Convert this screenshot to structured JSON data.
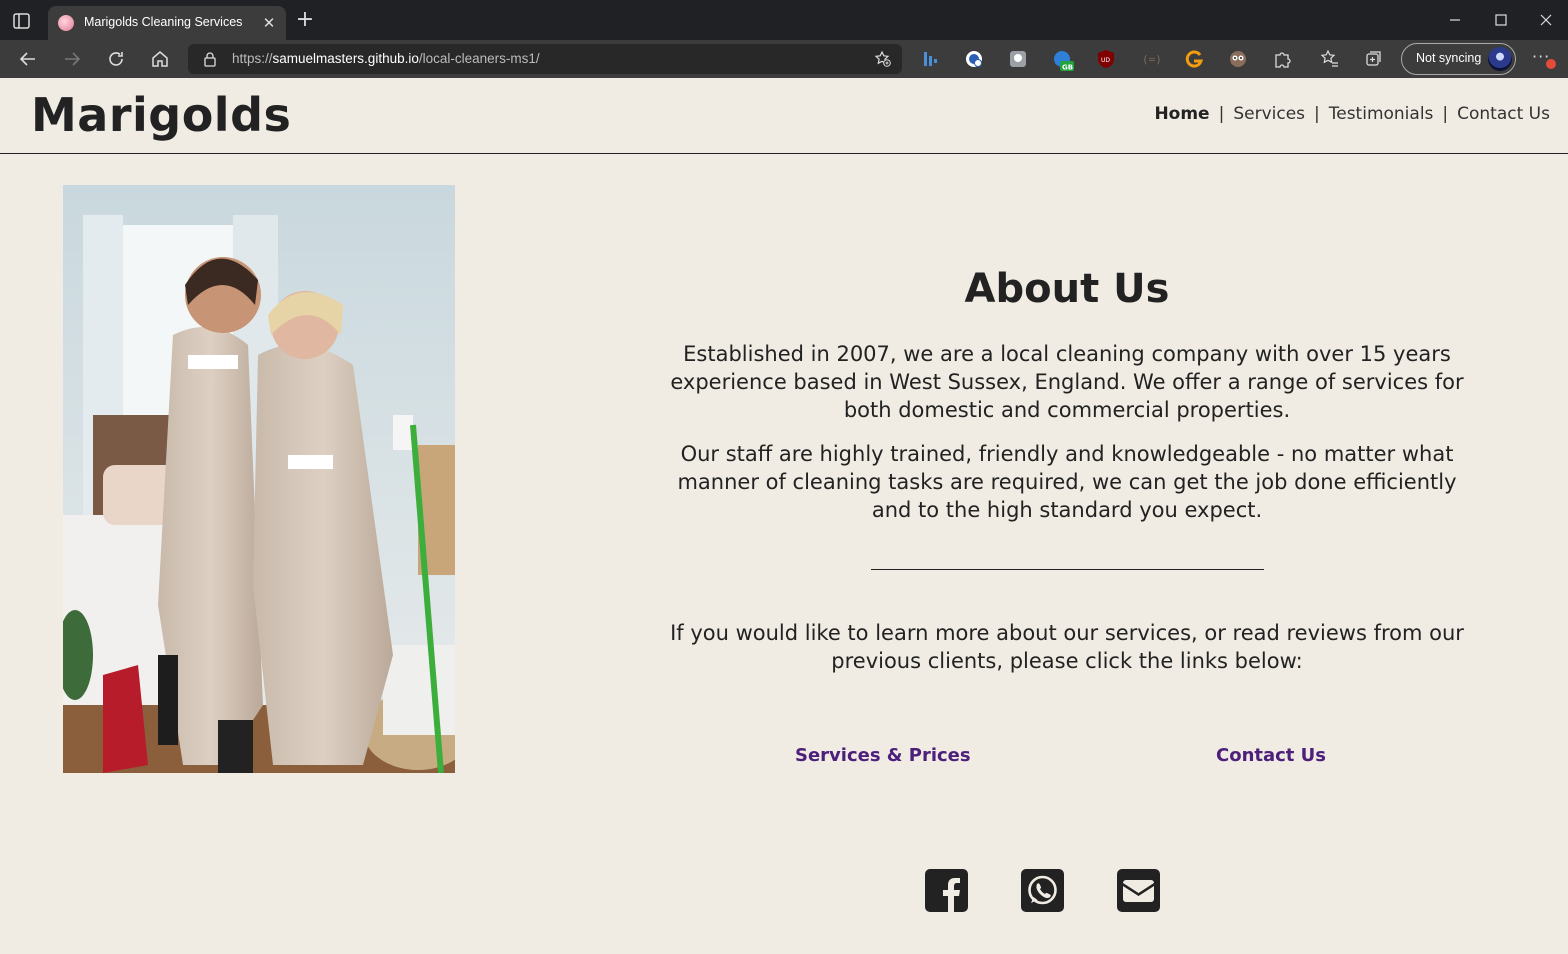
{
  "browser": {
    "tab_title": "Marigolds Cleaning Services",
    "url_scheme": "https://",
    "url_host": "samuelmasters.github.io",
    "url_path": "/local-cleaners-ms1/",
    "sync_label": "Not syncing",
    "extension_badge": "GB",
    "extension_badge_red": "UD",
    "extension_icons": [
      "bars-icon",
      "dictionary-icon",
      "notebook-icon",
      "globe-extension-icon",
      "ublock-icon",
      "bracket-extension-icon",
      "g-extension-icon",
      "eyes-extension-icon",
      "puzzle-icon"
    ]
  },
  "site": {
    "brand": "Marigolds",
    "nav": {
      "home": "Home",
      "services": "Services",
      "testimonials": "Testimonials",
      "contact": "Contact Us",
      "separator": "|",
      "active": "Home"
    }
  },
  "about": {
    "title": "About Us",
    "paragraph1": "Established in 2007, we are a local cleaning company with over 15 years experience based in West Sussex, England. We offer a range of services for both domestic and commercial properties.",
    "paragraph2": "Our staff are highly trained, friendly and knowledgeable - no matter what manner of cleaning tasks are required, we can get the job done efficiently and to the high standard you expect.",
    "paragraph3": "If you would like to learn more about our services, or read reviews from our previous clients, please click the links below:",
    "link_services": "Services & Prices",
    "link_contact": "Contact Us"
  },
  "social": [
    "facebook-icon",
    "whatsapp-icon",
    "email-icon"
  ],
  "colors": {
    "page_background": "#f0ebe3",
    "text": "#222222",
    "link": "#4b1f7a",
    "browser_dark": "#202124",
    "browser_toolbar": "#3c3c3c"
  }
}
